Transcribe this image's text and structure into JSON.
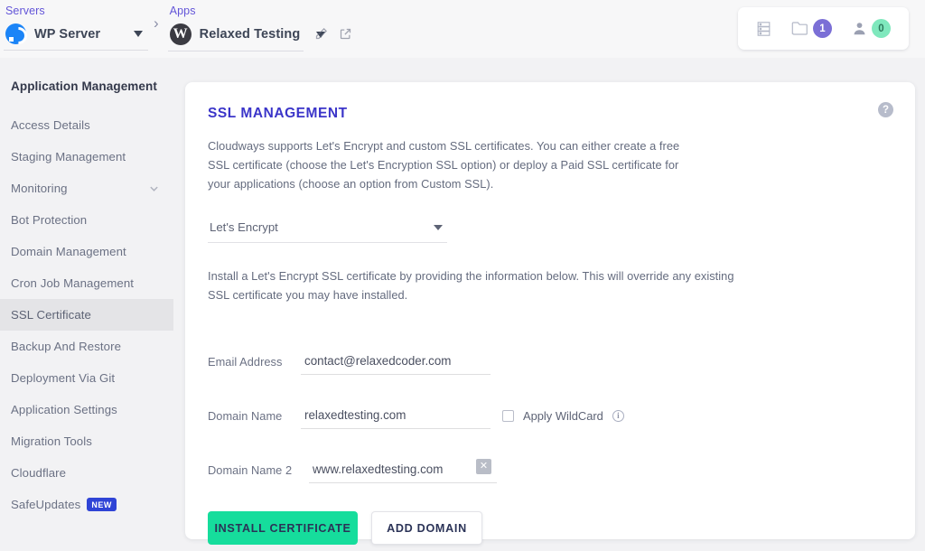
{
  "breadcrumb": {
    "servers": {
      "label": "Servers",
      "name": "WP Server"
    },
    "separator": "›",
    "apps": {
      "label": "Apps",
      "name": "Relaxed Testing"
    }
  },
  "topbar_icons": {
    "list_icon": "server-list-icon",
    "projects": {
      "icon": "folder-icon",
      "count": "1"
    },
    "team": {
      "icon": "user-icon",
      "count": "0"
    }
  },
  "sidebar": {
    "title": "Application Management",
    "items": [
      {
        "label": "Access Details",
        "active": false,
        "chevron": false,
        "badge": null
      },
      {
        "label": "Staging Management",
        "active": false,
        "chevron": false,
        "badge": null
      },
      {
        "label": "Monitoring",
        "active": false,
        "chevron": true,
        "badge": null
      },
      {
        "label": "Bot Protection",
        "active": false,
        "chevron": false,
        "badge": null
      },
      {
        "label": "Domain Management",
        "active": false,
        "chevron": false,
        "badge": null
      },
      {
        "label": "Cron Job Management",
        "active": false,
        "chevron": false,
        "badge": null
      },
      {
        "label": "SSL Certificate",
        "active": true,
        "chevron": false,
        "badge": null
      },
      {
        "label": "Backup And Restore",
        "active": false,
        "chevron": false,
        "badge": null
      },
      {
        "label": "Deployment Via Git",
        "active": false,
        "chevron": false,
        "badge": null
      },
      {
        "label": "Application Settings",
        "active": false,
        "chevron": false,
        "badge": null
      },
      {
        "label": "Migration Tools",
        "active": false,
        "chevron": false,
        "badge": null
      },
      {
        "label": "Cloudflare",
        "active": false,
        "chevron": false,
        "badge": null
      },
      {
        "label": "SafeUpdates",
        "active": false,
        "chevron": false,
        "badge": "NEW"
      }
    ]
  },
  "main": {
    "title": "SSL MANAGEMENT",
    "description": "Cloudways supports Let's Encrypt and custom SSL certificates. You can either create a free SSL certificate (choose the Let's Encryption SSL option) or deploy a Paid SSL certificate for your applications (choose an option from Custom SSL).",
    "help_icon": "?",
    "ssl_type": {
      "selected": "Let's Encrypt"
    },
    "note": "Install a Let's Encrypt SSL certificate by providing the information below. This will override any existing SSL certificate you may have installed.",
    "fields": {
      "email": {
        "label": "Email Address",
        "value": "contact@relaxedcoder.com"
      },
      "domain1": {
        "label": "Domain Name",
        "value": "relaxedtesting.com"
      },
      "domain2": {
        "label": "Domain Name 2",
        "value": "www.relaxedtesting.com",
        "clear": "✕"
      }
    },
    "wildcard": {
      "label": "Apply WildCard",
      "checked": false,
      "info": "i"
    },
    "buttons": {
      "install": "INSTALL CERTIFICATE",
      "add_domain": "ADD DOMAIN"
    }
  },
  "colors": {
    "accent_title": "#3b35c9",
    "primary_button": "#16dd9c",
    "badge_purple": "#7b6fd6",
    "badge_green": "#7fe8bd",
    "new_badge": "#2f44d6"
  }
}
